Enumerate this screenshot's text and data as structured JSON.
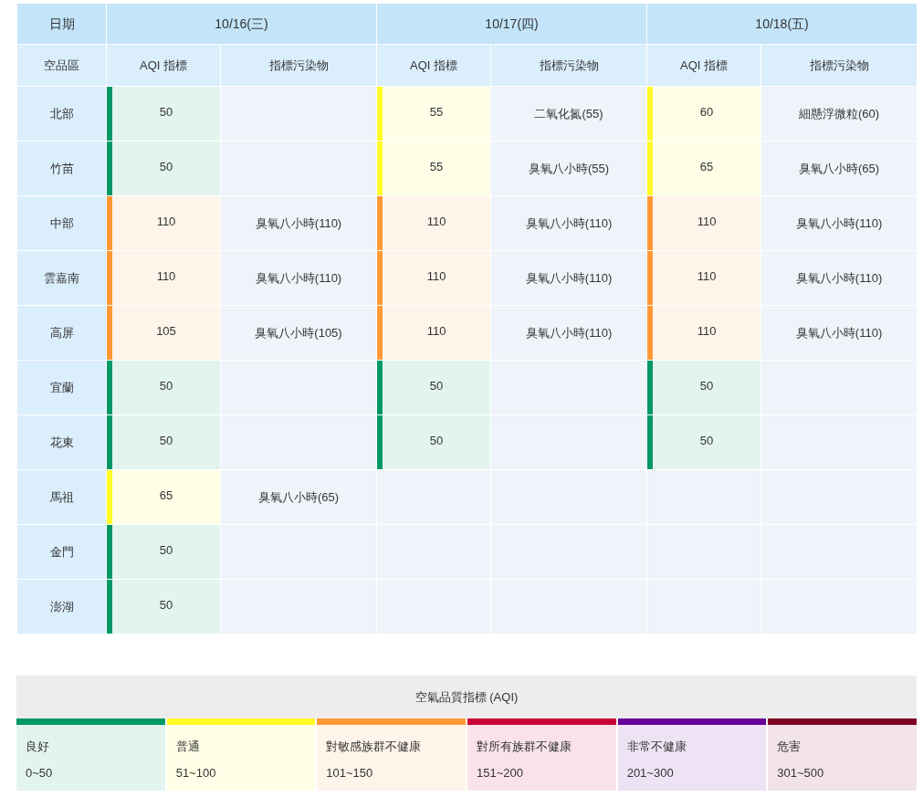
{
  "table": {
    "date_label": "日期",
    "region_label": "空品區",
    "dates": [
      {
        "date": "10/16(三)",
        "aqi_label": "AQI 指標",
        "pollutant_label": "指標污染物"
      },
      {
        "date": "10/17(四)",
        "aqi_label": "AQI 指標",
        "pollutant_label": "指標污染物"
      },
      {
        "date": "10/18(五)",
        "aqi_label": "AQI 指標",
        "pollutant_label": "指標污染物"
      }
    ],
    "rows": [
      {
        "region": "北部",
        "days": [
          {
            "aqi": "50",
            "color": "#009865"
          },
          {
            "aqi": "55",
            "pollutant": "二氧化氮(55)",
            "color": "#fffb26"
          },
          {
            "aqi": "60",
            "pollutant": "細懸浮微粒(60)",
            "color": "#fffb26"
          }
        ]
      },
      {
        "region": "竹苗",
        "days": [
          {
            "aqi": "50",
            "color": "#009865"
          },
          {
            "aqi": "55",
            "pollutant": "臭氧八小時(55)",
            "color": "#fffb26"
          },
          {
            "aqi": "65",
            "pollutant": "臭氧八小時(65)",
            "color": "#fffb26"
          }
        ]
      },
      {
        "region": "中部",
        "days": [
          {
            "aqi": "110",
            "pollutant": "臭氧八小時(110)",
            "color": "#ff9835"
          },
          {
            "aqi": "110",
            "pollutant": "臭氧八小時(110)",
            "color": "#ff9835"
          },
          {
            "aqi": "110",
            "pollutant": "臭氧八小時(110)",
            "color": "#ff9835"
          }
        ]
      },
      {
        "region": "雲嘉南",
        "days": [
          {
            "aqi": "110",
            "pollutant": "臭氧八小時(110)",
            "color": "#ff9835"
          },
          {
            "aqi": "110",
            "pollutant": "臭氧八小時(110)",
            "color": "#ff9835"
          },
          {
            "aqi": "110",
            "pollutant": "臭氧八小時(110)",
            "color": "#ff9835"
          }
        ]
      },
      {
        "region": "高屏",
        "days": [
          {
            "aqi": "105",
            "pollutant": "臭氧八小時(105)",
            "color": "#ff9835"
          },
          {
            "aqi": "110",
            "pollutant": "臭氧八小時(110)",
            "color": "#ff9835"
          },
          {
            "aqi": "110",
            "pollutant": "臭氧八小時(110)",
            "color": "#ff9835"
          }
        ]
      },
      {
        "region": "宜蘭",
        "days": [
          {
            "aqi": "50",
            "color": "#009865"
          },
          {
            "aqi": "50",
            "color": "#009865"
          },
          {
            "aqi": "50",
            "color": "#009865"
          }
        ]
      },
      {
        "region": "花東",
        "days": [
          {
            "aqi": "50",
            "color": "#009865"
          },
          {
            "aqi": "50",
            "color": "#009865"
          },
          {
            "aqi": "50",
            "color": "#009865"
          }
        ]
      },
      {
        "region": "馬祖",
        "days": [
          {
            "aqi": "65",
            "pollutant": "臭氧八小時(65)",
            "color": "#fffb26"
          }
        ]
      },
      {
        "region": "金門",
        "days": [
          {
            "aqi": "50",
            "color": "#009865"
          }
        ]
      },
      {
        "region": "澎湖",
        "days": [
          {
            "aqi": "50",
            "color": "#009865"
          }
        ]
      }
    ]
  },
  "legend": {
    "title": "空氣品質指標 (AQI)",
    "levels": [
      {
        "label": "良好",
        "range": "0~50",
        "color": "#009865"
      },
      {
        "label": "普通",
        "range": "51~100",
        "color": "#fffb26"
      },
      {
        "label": "對敏感族群不健康",
        "range": "101~150",
        "color": "#ff9835"
      },
      {
        "label": "對所有族群不健康",
        "range": "151~200",
        "color": "#ca0034"
      },
      {
        "label": "非常不健康",
        "range": "201~300",
        "color": "#670099"
      },
      {
        "label": "危害",
        "range": "301~500",
        "color": "#7e0123"
      }
    ]
  }
}
